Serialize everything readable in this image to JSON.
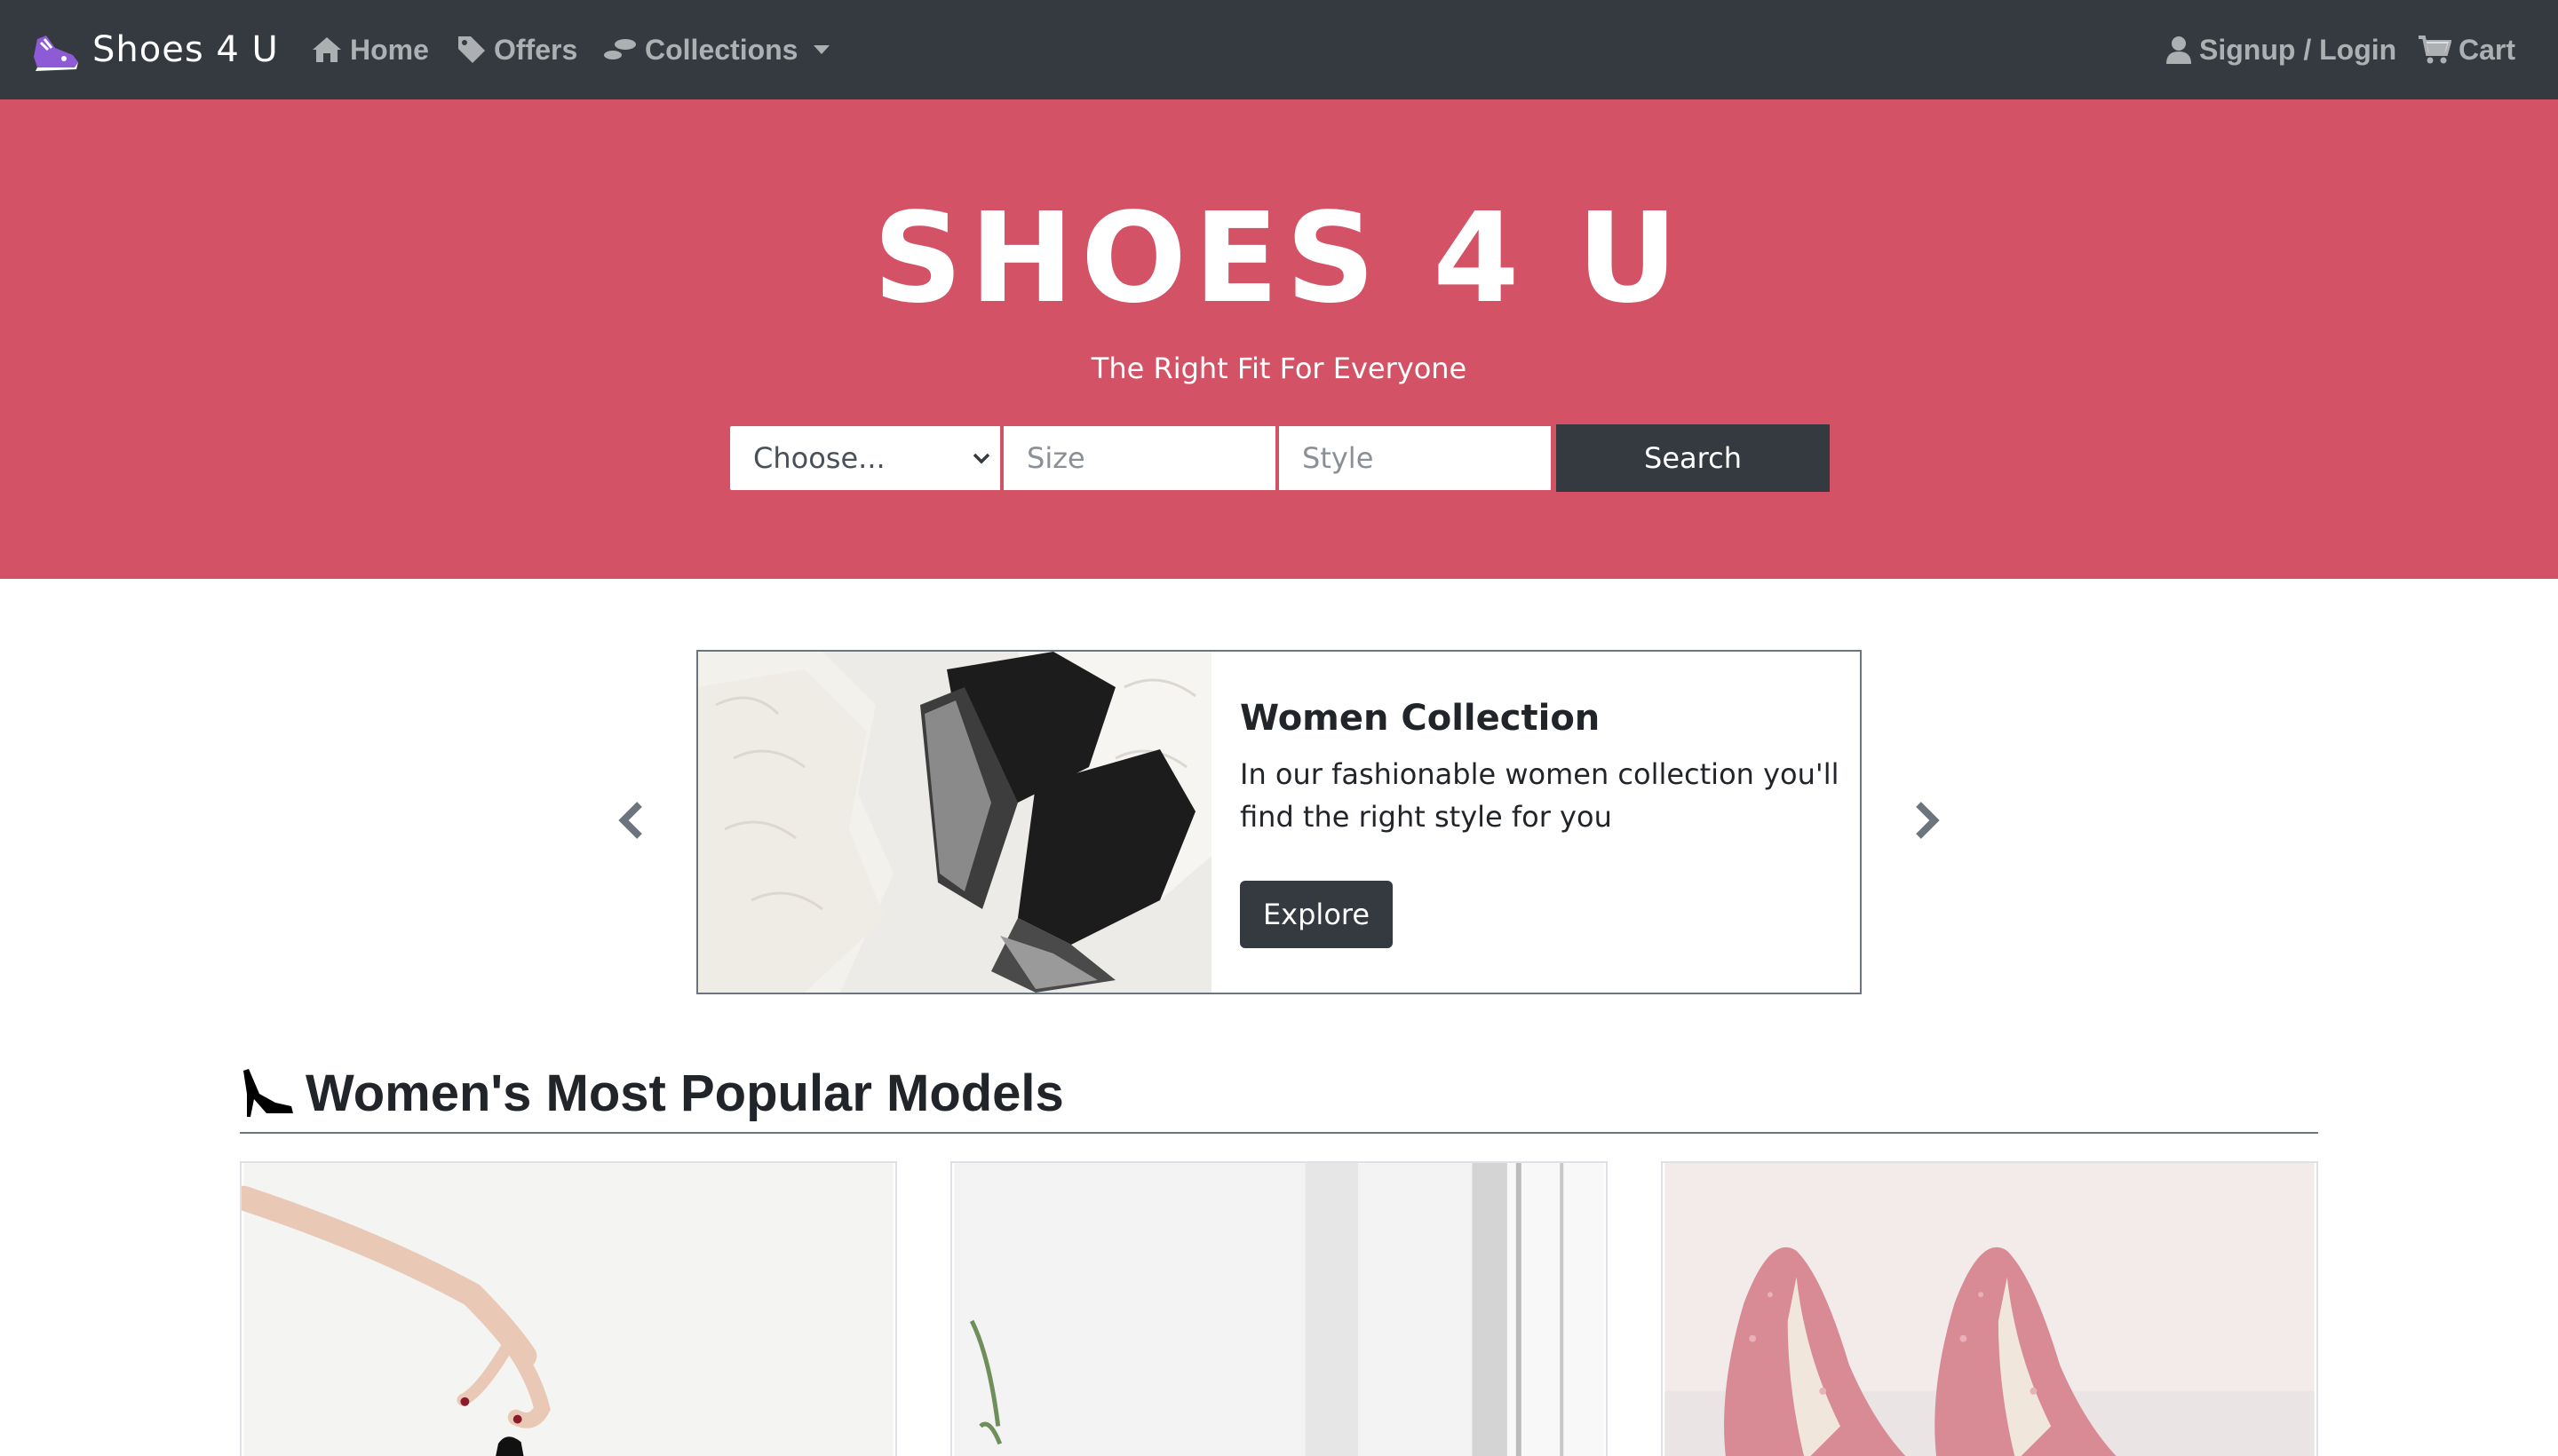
{
  "nav": {
    "brand": "Shoes 4 U",
    "home": "Home",
    "offers": "Offers",
    "collections": "Collections",
    "signup": "Signup / Login",
    "cart": "Cart"
  },
  "hero": {
    "title": "SHOES 4 U",
    "subtitle": "The Right Fit For Everyone",
    "select_value": "Choose...",
    "size_placeholder": "Size",
    "style_placeholder": "Style",
    "search_label": "Search"
  },
  "carousel": {
    "title": "Women Collection",
    "text": "In our fashionable women collection you'll find the right style for you",
    "button": "Explore"
  },
  "popular": {
    "title": "Women's Most Popular Models"
  },
  "colors": {
    "navbar": "#343a40",
    "hero": "#d45266",
    "button_dark": "#343a40"
  }
}
